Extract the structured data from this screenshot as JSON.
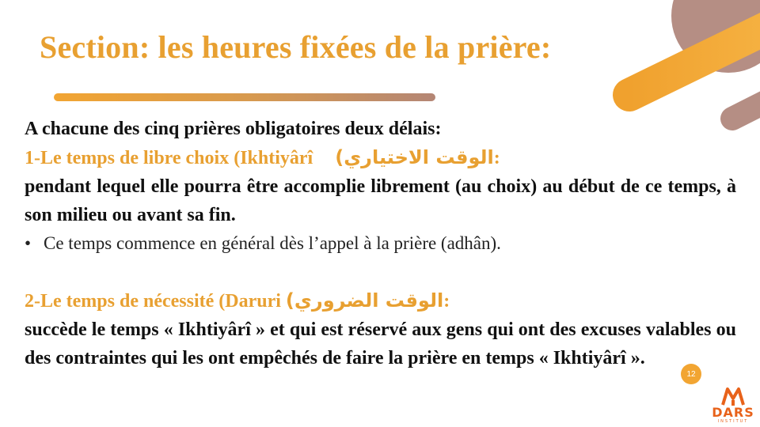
{
  "slide": {
    "title": "Section: les heures fixées de la prière:",
    "intro": "A chacune des cinq prières obligatoires deux délais:",
    "item1": {
      "heading_fr": "1-Le temps de libre choix (Ikhtiyârî",
      "heading_ar": "الوقت الاختياري)",
      "heading_end": ":",
      "body": "pendant lequel elle pourra être accomplie librement (au choix) au début de ce temps, à son milieu ou avant sa fin.",
      "bullet": "Ce temps commence en général dès l’appel à la prière (adhân)."
    },
    "item2": {
      "heading_fr": "2-Le temps de nécessité (Daruri",
      "heading_ar": "الوقت الضروري)",
      "heading_end": ":",
      "body": "succède le temps « Ikhtiyârî » et qui est réservé aux gens qui ont des excuses valables ou des contraintes qui les ont empêchés de faire la prière en temps « Ikhtiyârî »."
    },
    "page_number": "12"
  },
  "logo": {
    "name": "DARS",
    "subtitle": "INSTITUT"
  },
  "colors": {
    "accent": "#e8a031",
    "brown": "#b48675",
    "logo": "#e8621a"
  }
}
